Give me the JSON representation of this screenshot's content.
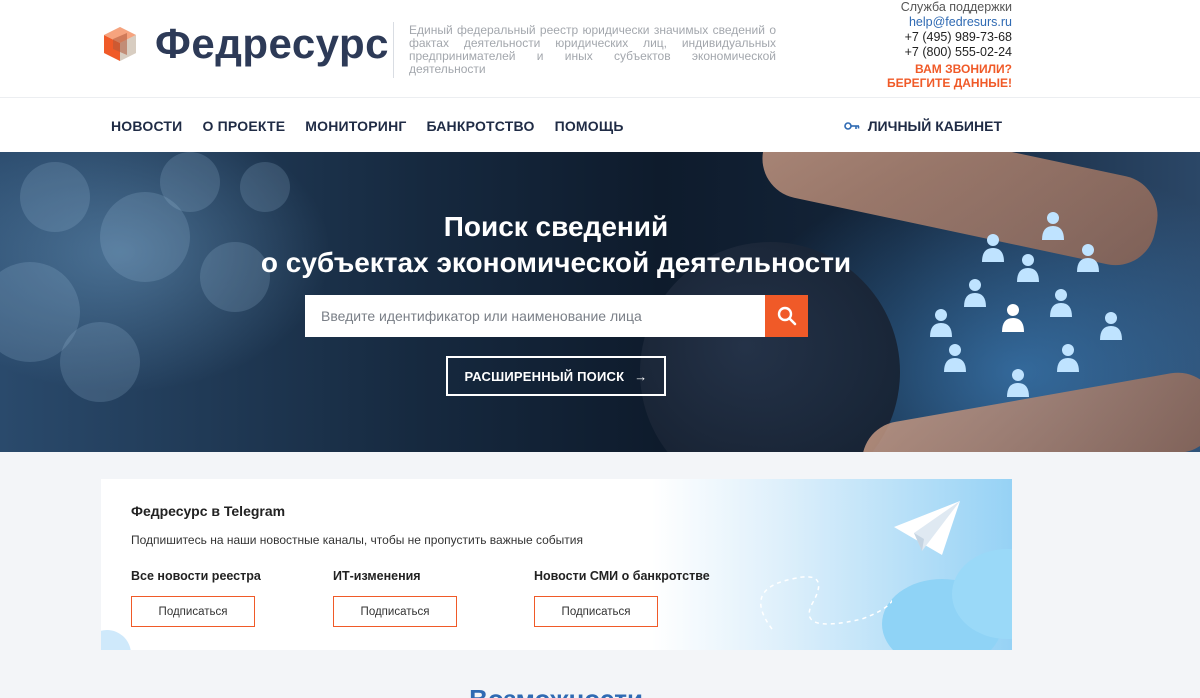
{
  "header": {
    "logo_text": "Федресурс",
    "tagline": "Единый федеральный реестр юридически значимых сведений о фактах деятельности юридических лиц, индивидуальных предпринимателей и иных субъектов экономической деятельности",
    "support_label": "Служба поддержки",
    "support_email": "help@fedresurs.ru",
    "phone_1": "+7 (495) 989-73-68",
    "phone_2": "+7 (800) 555-02-24",
    "warning_1": "ВАМ ЗВОНИЛИ?",
    "warning_2": "БЕРЕГИТЕ ДАННЫЕ!"
  },
  "nav": {
    "items": [
      {
        "label": "НОВОСТИ"
      },
      {
        "label": "О ПРОЕКТЕ"
      },
      {
        "label": "МОНИТОРИНГ"
      },
      {
        "label": "БАНКРОТСТВО"
      },
      {
        "label": "ПОМОЩЬ"
      }
    ],
    "cabinet_label": "ЛИЧНЫЙ КАБИНЕТ"
  },
  "hero": {
    "title_line_1": "Поиск сведений",
    "title_line_2": "о субъектах экономической деятельности",
    "search_placeholder": "Введите идентификатор или наименование лица",
    "advanced_search_label": "РАСШИРЕННЫЙ ПОИСК",
    "advanced_search_arrow": "→"
  },
  "telegram": {
    "title": "Федресурс в Telegram",
    "subtitle": "Подпишитесь на наши новостные каналы, чтобы не пропустить важные события",
    "channels": [
      {
        "title": "Все новости реестра",
        "button": "Подписаться"
      },
      {
        "title": "ИТ-изменения",
        "button": "Подписаться"
      },
      {
        "title": "Новости СМИ о банкротстве",
        "button": "Подписаться"
      }
    ]
  },
  "next_section": {
    "heading": "Возможности"
  },
  "colors": {
    "accent": "#f05a28",
    "brand_dark": "#2d3a57",
    "link": "#2f6ab3"
  },
  "icons": [
    "logo-cube-icon",
    "key-icon",
    "search-icon",
    "arrow-right-icon",
    "paper-plane-icon",
    "person-icon"
  ]
}
